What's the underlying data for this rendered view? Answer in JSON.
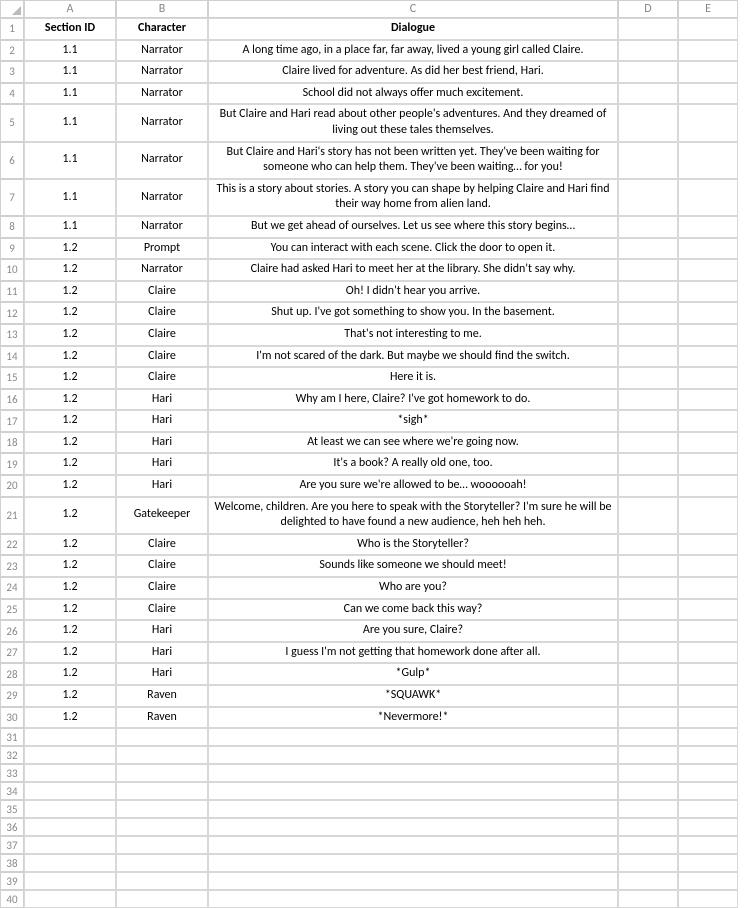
{
  "columns": [
    "A",
    "B",
    "C",
    "D",
    "E"
  ],
  "headers": {
    "A": "Section ID",
    "B": "Character",
    "C": "Dialogue",
    "D": "",
    "E": ""
  },
  "rows": [
    {
      "n": 2,
      "A": "1.1",
      "B": "Narrator",
      "C": "A long time ago, in a place far, far away, lived a young girl called Claire."
    },
    {
      "n": 3,
      "A": "1.1",
      "B": "Narrator",
      "C": "Claire lived for adventure. As did her best friend, Hari."
    },
    {
      "n": 4,
      "A": "1.1",
      "B": "Narrator",
      "C": "School did not always offer much excitement."
    },
    {
      "n": 5,
      "A": "1.1",
      "B": "Narrator",
      "C": "But Claire and Hari read about other people's adventures. And they dreamed of living out these tales themselves.",
      "multi": true
    },
    {
      "n": 6,
      "A": "1.1",
      "B": "Narrator",
      "C": "But Claire and Hari's story has not been written yet. They've been waiting for someone who can help them. They've been waiting… for you!",
      "multi": true
    },
    {
      "n": 7,
      "A": "1.1",
      "B": "Narrator",
      "C": "This is a story about stories. A story you can shape by helping Claire and Hari find their way home from alien land.",
      "multi": true
    },
    {
      "n": 8,
      "A": "1.1",
      "B": "Narrator",
      "C": "But we get ahead of ourselves. Let us see where this story begins…"
    },
    {
      "n": 9,
      "A": "1.2",
      "B": "Prompt",
      "C": "You can interact with each scene. Click the door to open it."
    },
    {
      "n": 10,
      "A": "1.2",
      "B": "Narrator",
      "C": "Claire had asked Hari to meet her at the library. She didn't say why."
    },
    {
      "n": 11,
      "A": "1.2",
      "B": "Claire",
      "C": "Oh! I didn't hear you arrive."
    },
    {
      "n": 12,
      "A": "1.2",
      "B": "Claire",
      "C": "Shut up. I've got something to show you. In the basement."
    },
    {
      "n": 13,
      "A": "1.2",
      "B": "Claire",
      "C": "That's not interesting to me."
    },
    {
      "n": 14,
      "A": "1.2",
      "B": "Claire",
      "C": "I'm not scared of the dark. But maybe we should find the switch."
    },
    {
      "n": 15,
      "A": "1.2",
      "B": "Claire",
      "C": "Here it is."
    },
    {
      "n": 16,
      "A": "1.2",
      "B": "Hari",
      "C": "Why am I here, Claire? I've got homework to do."
    },
    {
      "n": 17,
      "A": "1.2",
      "B": "Hari",
      "C": "*sigh*"
    },
    {
      "n": 18,
      "A": "1.2",
      "B": "Hari",
      "C": "At least we can see where we're going now."
    },
    {
      "n": 19,
      "A": "1.2",
      "B": "Hari",
      "C": "It's a book? A really old one, too."
    },
    {
      "n": 20,
      "A": "1.2",
      "B": "Hari",
      "C": "Are you sure we're allowed to be… woooooah!"
    },
    {
      "n": 21,
      "A": "1.2",
      "B": "Gatekeeper",
      "C": "Welcome, children. Are you here to speak with the Storyteller? I'm sure he will be delighted to have found a new audience, heh heh heh.",
      "multi": true
    },
    {
      "n": 22,
      "A": "1.2",
      "B": "Claire",
      "C": "Who is the Storyteller?"
    },
    {
      "n": 23,
      "A": "1.2",
      "B": "Claire",
      "C": "Sounds like someone we should meet!"
    },
    {
      "n": 24,
      "A": "1.2",
      "B": "Claire",
      "C": "Who are you?"
    },
    {
      "n": 25,
      "A": "1.2",
      "B": "Claire",
      "C": "Can we come back this way?"
    },
    {
      "n": 26,
      "A": "1.2",
      "B": "Hari",
      "C": "Are you sure, Claire?"
    },
    {
      "n": 27,
      "A": "1.2",
      "B": "Hari",
      "C": "I guess I'm not getting that homework done after all."
    },
    {
      "n": 28,
      "A": "1.2",
      "B": "Hari",
      "C": "*Gulp*"
    },
    {
      "n": 29,
      "A": "1.2",
      "B": "Raven",
      "C": "*SQUAWK*"
    },
    {
      "n": 30,
      "A": "1.2",
      "B": "Raven",
      "C": "*Nevermore!*"
    },
    {
      "n": 31,
      "A": "",
      "B": "",
      "C": ""
    },
    {
      "n": 32,
      "A": "",
      "B": "",
      "C": ""
    },
    {
      "n": 33,
      "A": "",
      "B": "",
      "C": ""
    },
    {
      "n": 34,
      "A": "",
      "B": "",
      "C": ""
    },
    {
      "n": 35,
      "A": "",
      "B": "",
      "C": ""
    },
    {
      "n": 36,
      "A": "",
      "B": "",
      "C": ""
    },
    {
      "n": 37,
      "A": "",
      "B": "",
      "C": ""
    },
    {
      "n": 38,
      "A": "",
      "B": "",
      "C": ""
    },
    {
      "n": 39,
      "A": "",
      "B": "",
      "C": ""
    },
    {
      "n": 40,
      "A": "",
      "B": "",
      "C": ""
    }
  ]
}
